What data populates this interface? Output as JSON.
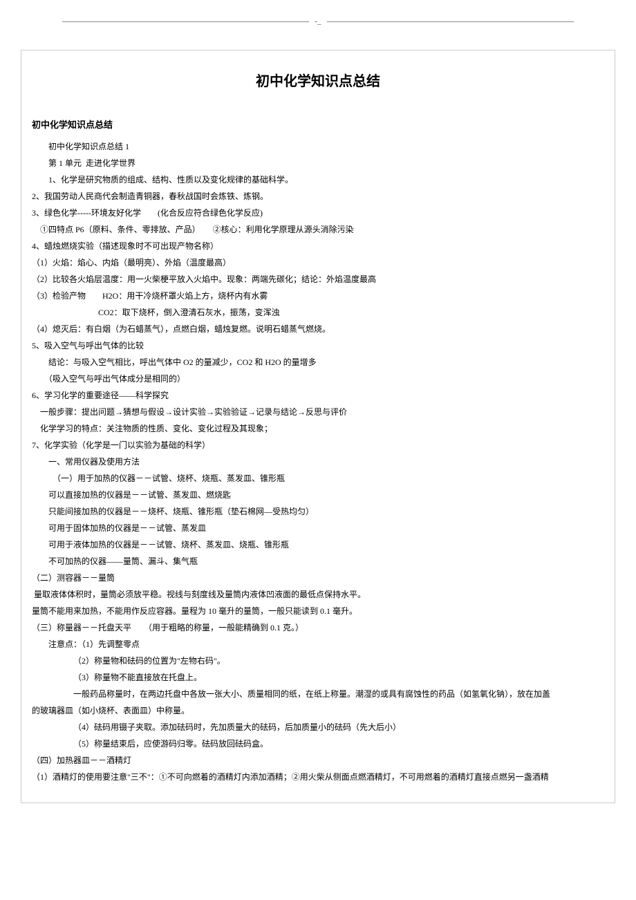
{
  "header_dash": "-_",
  "title": "初中化学知识点总结",
  "subtitle": "初中化学知识点总结",
  "lines": [
    {
      "cls": "indent1",
      "t": "初中化学知识点总结 1"
    },
    {
      "cls": "indent1",
      "t": "第 1 单元  走进化学世界"
    },
    {
      "cls": "indent1",
      "t": "1、化学是研究物质的组成、结构、性质以及变化规律的基础科学。"
    },
    {
      "cls": "",
      "t": "2、我国劳动人民商代会制造青铜器，春秋战国时会炼铁、炼钢。"
    },
    {
      "cls": "",
      "t": "3、绿色化学-----环境友好化学　　(化合反应符合绿色化学反应)"
    },
    {
      "cls": "",
      "t": "　①四特点 P6（原料、条件、零排放、产品）　　②核心：利用化学原理从源头消除污染"
    },
    {
      "cls": "",
      "t": "4、蜡烛燃烧实验（描述现象时不可出现产物名称）"
    },
    {
      "cls": "",
      "t": "（1）火焰：焰心、内焰（最明亮）、外焰（温度最高）"
    },
    {
      "cls": "",
      "t": "（2）比较各火焰层温度：用一火柴梗平放入火焰中。现象：两端先碳化；结论：外焰温度最高"
    },
    {
      "cls": "",
      "t": "（3）检验产物　　H2O：用干冷烧杯罩火焰上方，烧杯内有水雾"
    },
    {
      "cls": "",
      "t": "　　　　　　　　CO2：取下烧杯，倒入澄清石灰水，振荡，变浑浊"
    },
    {
      "cls": "",
      "t": "（4）熄灭后：有白烟（为石蜡蒸气），点燃白烟，蜡烛复燃。说明石蜡蒸气燃烧。"
    },
    {
      "cls": "",
      "t": "5、吸入空气与呼出气体的比较"
    },
    {
      "cls": "",
      "t": "　　结论：与吸入空气相比，呼出气体中 O2 的量减少，CO2 和 H2O 的量增多"
    },
    {
      "cls": "",
      "t": "　　（吸入空气与呼出气体成分是相同的）"
    },
    {
      "cls": "",
      "t": "6、学习化学的重要途径——科学探究"
    },
    {
      "cls": "",
      "t": "　一般步骤：提出问题→猜想与假设→设计实验→实验验证→记录与结论→反思与评价"
    },
    {
      "cls": "",
      "t": "　化学学习的特点：关注物质的性质、变化、变化过程及其现象；"
    },
    {
      "cls": "",
      "t": "7、化学实验（化学是一门以实验为基础的科学）"
    },
    {
      "cls": "indent1",
      "t": "一、常用仪器及使用方法"
    },
    {
      "cls": "indent1",
      "t": "　（一）用于加热的仪器－－试管、烧杯、烧瓶、蒸发皿、锥形瓶"
    },
    {
      "cls": "indent1",
      "t": "可以直接加热的仪器是－－试管、蒸发皿、燃烧匙"
    },
    {
      "cls": "indent1",
      "t": "只能间接加热的仪器是－－烧杯、烧瓶、锥形瓶（垫石棉网—受热均匀）"
    },
    {
      "cls": "indent1",
      "t": "可用于固体加热的仪器是－－试管、蒸发皿"
    },
    {
      "cls": "indent1",
      "t": "可用于液体加热的仪器是－－试管、烧杯、蒸发皿、烧瓶、锥形瓶"
    },
    {
      "cls": "indent1",
      "t": "不可加热的仪器——量筒、漏斗、集气瓶"
    },
    {
      "cls": "",
      "t": "（二）测容器－－量筒"
    },
    {
      "cls": "",
      "t": " 量取液体体积时，量筒必须放平稳。视线与刻度线及量筒内液体凹液面的最低点保持水平。"
    },
    {
      "cls": "",
      "t": "量筒不能用来加热，不能用作反应容器。量程为 10 毫升的量筒，一般只能读到 0.1 毫升。"
    },
    {
      "cls": "",
      "t": "（三）称量器－－托盘天平　　（用于粗略的称量，一般能精确到 0.1 克。）"
    },
    {
      "cls": "indent1",
      "t": "注意点：（1）先调整零点"
    },
    {
      "cls": "indent3",
      "t": "（2）称量物和砝码的位置为\"左物右码\"。"
    },
    {
      "cls": "indent3",
      "t": "（3）称量物不能直接放在托盘上。"
    },
    {
      "cls": "indent3",
      "t": "一般药品称量时，在两边托盘中各放一张大小、质量相同的纸，在纸上称量。潮湿的或具有腐蚀性的药品（如氢氧化钠），放在加盖"
    },
    {
      "cls": "",
      "t": "的玻璃器皿（如小烧杯、表面皿）中称量。"
    },
    {
      "cls": "indent3",
      "t": "（4）砝码用镊子夹取。添加砝码时，先加质量大的砝码，后加质量小的砝码（先大后小）"
    },
    {
      "cls": "indent3",
      "t": "（5）称量结束后，应使游码归零。砝码放回砝码盒。"
    },
    {
      "cls": "",
      "t": "（四）加热器皿－－酒精灯"
    },
    {
      "cls": "",
      "t": "（1）酒精灯的使用要注意\"三不\"：①不可向燃着的酒精灯内添加酒精；②用火柴从侧面点燃酒精灯，不可用燃着的酒精灯直接点燃另一盏酒精"
    }
  ]
}
